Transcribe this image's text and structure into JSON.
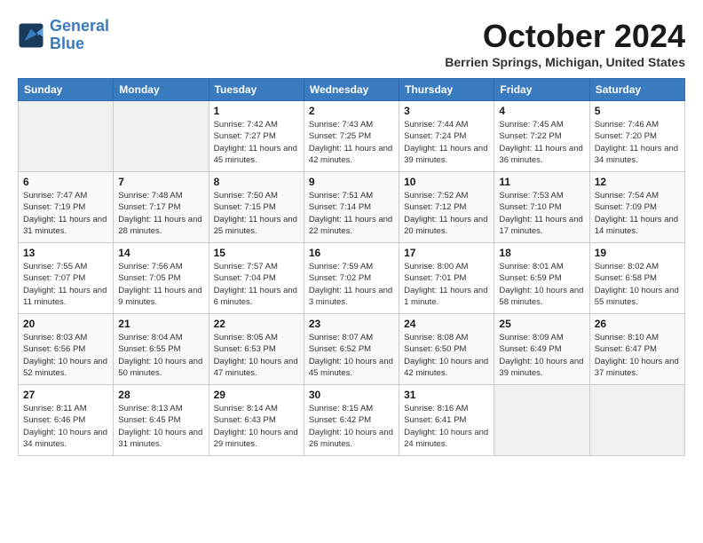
{
  "header": {
    "logo": {
      "line1": "General",
      "line2": "Blue"
    },
    "month": "October 2024",
    "location": "Berrien Springs, Michigan, United States"
  },
  "weekdays": [
    "Sunday",
    "Monday",
    "Tuesday",
    "Wednesday",
    "Thursday",
    "Friday",
    "Saturday"
  ],
  "weeks": [
    [
      {
        "day": "",
        "empty": true
      },
      {
        "day": "",
        "empty": true
      },
      {
        "day": "1",
        "sunrise": "Sunrise: 7:42 AM",
        "sunset": "Sunset: 7:27 PM",
        "daylight": "Daylight: 11 hours and 45 minutes."
      },
      {
        "day": "2",
        "sunrise": "Sunrise: 7:43 AM",
        "sunset": "Sunset: 7:25 PM",
        "daylight": "Daylight: 11 hours and 42 minutes."
      },
      {
        "day": "3",
        "sunrise": "Sunrise: 7:44 AM",
        "sunset": "Sunset: 7:24 PM",
        "daylight": "Daylight: 11 hours and 39 minutes."
      },
      {
        "day": "4",
        "sunrise": "Sunrise: 7:45 AM",
        "sunset": "Sunset: 7:22 PM",
        "daylight": "Daylight: 11 hours and 36 minutes."
      },
      {
        "day": "5",
        "sunrise": "Sunrise: 7:46 AM",
        "sunset": "Sunset: 7:20 PM",
        "daylight": "Daylight: 11 hours and 34 minutes."
      }
    ],
    [
      {
        "day": "6",
        "sunrise": "Sunrise: 7:47 AM",
        "sunset": "Sunset: 7:19 PM",
        "daylight": "Daylight: 11 hours and 31 minutes."
      },
      {
        "day": "7",
        "sunrise": "Sunrise: 7:48 AM",
        "sunset": "Sunset: 7:17 PM",
        "daylight": "Daylight: 11 hours and 28 minutes."
      },
      {
        "day": "8",
        "sunrise": "Sunrise: 7:50 AM",
        "sunset": "Sunset: 7:15 PM",
        "daylight": "Daylight: 11 hours and 25 minutes."
      },
      {
        "day": "9",
        "sunrise": "Sunrise: 7:51 AM",
        "sunset": "Sunset: 7:14 PM",
        "daylight": "Daylight: 11 hours and 22 minutes."
      },
      {
        "day": "10",
        "sunrise": "Sunrise: 7:52 AM",
        "sunset": "Sunset: 7:12 PM",
        "daylight": "Daylight: 11 hours and 20 minutes."
      },
      {
        "day": "11",
        "sunrise": "Sunrise: 7:53 AM",
        "sunset": "Sunset: 7:10 PM",
        "daylight": "Daylight: 11 hours and 17 minutes."
      },
      {
        "day": "12",
        "sunrise": "Sunrise: 7:54 AM",
        "sunset": "Sunset: 7:09 PM",
        "daylight": "Daylight: 11 hours and 14 minutes."
      }
    ],
    [
      {
        "day": "13",
        "sunrise": "Sunrise: 7:55 AM",
        "sunset": "Sunset: 7:07 PM",
        "daylight": "Daylight: 11 hours and 11 minutes."
      },
      {
        "day": "14",
        "sunrise": "Sunrise: 7:56 AM",
        "sunset": "Sunset: 7:05 PM",
        "daylight": "Daylight: 11 hours and 9 minutes."
      },
      {
        "day": "15",
        "sunrise": "Sunrise: 7:57 AM",
        "sunset": "Sunset: 7:04 PM",
        "daylight": "Daylight: 11 hours and 6 minutes."
      },
      {
        "day": "16",
        "sunrise": "Sunrise: 7:59 AM",
        "sunset": "Sunset: 7:02 PM",
        "daylight": "Daylight: 11 hours and 3 minutes."
      },
      {
        "day": "17",
        "sunrise": "Sunrise: 8:00 AM",
        "sunset": "Sunset: 7:01 PM",
        "daylight": "Daylight: 11 hours and 1 minute."
      },
      {
        "day": "18",
        "sunrise": "Sunrise: 8:01 AM",
        "sunset": "Sunset: 6:59 PM",
        "daylight": "Daylight: 10 hours and 58 minutes."
      },
      {
        "day": "19",
        "sunrise": "Sunrise: 8:02 AM",
        "sunset": "Sunset: 6:58 PM",
        "daylight": "Daylight: 10 hours and 55 minutes."
      }
    ],
    [
      {
        "day": "20",
        "sunrise": "Sunrise: 8:03 AM",
        "sunset": "Sunset: 6:56 PM",
        "daylight": "Daylight: 10 hours and 52 minutes."
      },
      {
        "day": "21",
        "sunrise": "Sunrise: 8:04 AM",
        "sunset": "Sunset: 6:55 PM",
        "daylight": "Daylight: 10 hours and 50 minutes."
      },
      {
        "day": "22",
        "sunrise": "Sunrise: 8:05 AM",
        "sunset": "Sunset: 6:53 PM",
        "daylight": "Daylight: 10 hours and 47 minutes."
      },
      {
        "day": "23",
        "sunrise": "Sunrise: 8:07 AM",
        "sunset": "Sunset: 6:52 PM",
        "daylight": "Daylight: 10 hours and 45 minutes."
      },
      {
        "day": "24",
        "sunrise": "Sunrise: 8:08 AM",
        "sunset": "Sunset: 6:50 PM",
        "daylight": "Daylight: 10 hours and 42 minutes."
      },
      {
        "day": "25",
        "sunrise": "Sunrise: 8:09 AM",
        "sunset": "Sunset: 6:49 PM",
        "daylight": "Daylight: 10 hours and 39 minutes."
      },
      {
        "day": "26",
        "sunrise": "Sunrise: 8:10 AM",
        "sunset": "Sunset: 6:47 PM",
        "daylight": "Daylight: 10 hours and 37 minutes."
      }
    ],
    [
      {
        "day": "27",
        "sunrise": "Sunrise: 8:11 AM",
        "sunset": "Sunset: 6:46 PM",
        "daylight": "Daylight: 10 hours and 34 minutes."
      },
      {
        "day": "28",
        "sunrise": "Sunrise: 8:13 AM",
        "sunset": "Sunset: 6:45 PM",
        "daylight": "Daylight: 10 hours and 31 minutes."
      },
      {
        "day": "29",
        "sunrise": "Sunrise: 8:14 AM",
        "sunset": "Sunset: 6:43 PM",
        "daylight": "Daylight: 10 hours and 29 minutes."
      },
      {
        "day": "30",
        "sunrise": "Sunrise: 8:15 AM",
        "sunset": "Sunset: 6:42 PM",
        "daylight": "Daylight: 10 hours and 26 minutes."
      },
      {
        "day": "31",
        "sunrise": "Sunrise: 8:16 AM",
        "sunset": "Sunset: 6:41 PM",
        "daylight": "Daylight: 10 hours and 24 minutes."
      },
      {
        "day": "",
        "empty": true
      },
      {
        "day": "",
        "empty": true
      }
    ]
  ]
}
